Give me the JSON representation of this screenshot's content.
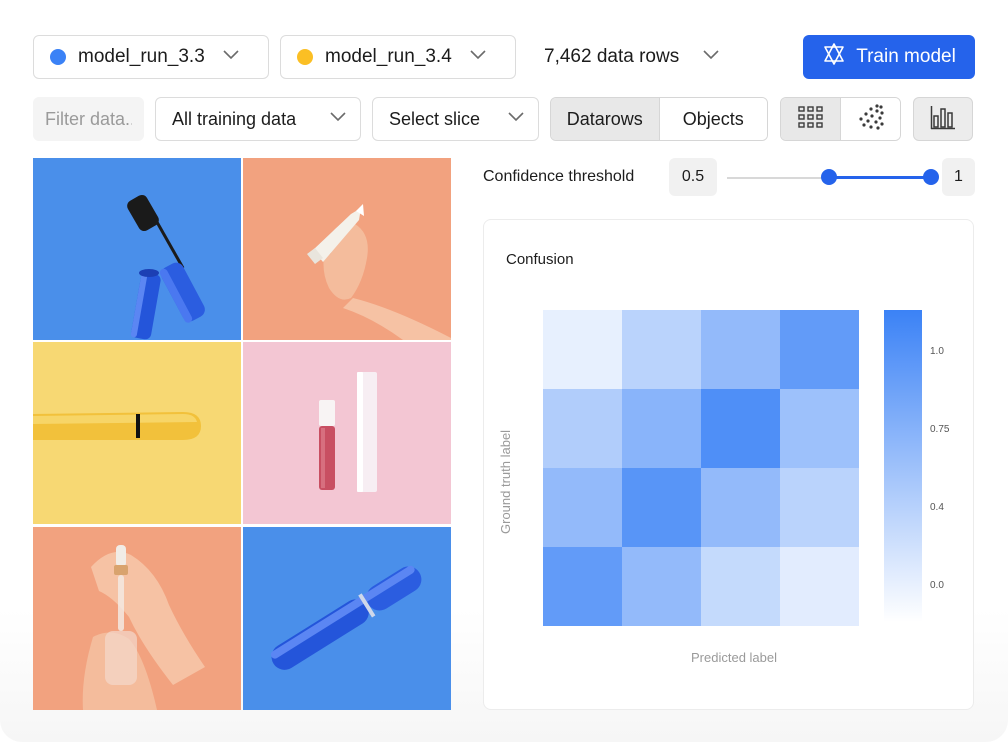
{
  "models": [
    {
      "name": "model_run_3.3",
      "color": "#3b82f6"
    },
    {
      "name": "model_run_3.4",
      "color": "#fbbf24"
    }
  ],
  "data_rows_label": "7,462 data rows",
  "train_button_label": "Train model",
  "filter": {
    "placeholder": "Filter data..."
  },
  "training_scope_select": {
    "value": "All training data"
  },
  "slice_select": {
    "value": "Select slice"
  },
  "mode_toggle": {
    "options": [
      "Datarows",
      "Objects"
    ],
    "active": "Datarows"
  },
  "view_toggle": {
    "options": [
      "grid-icon",
      "scatter-icon"
    ],
    "active": "grid-icon"
  },
  "chart_toggle_icon": "bar-chart-icon",
  "thumbnails": [
    {
      "subject": "mascara",
      "background": "#4a8fea"
    },
    {
      "subject": "hand-tube",
      "background": "#f2a27f"
    },
    {
      "subject": "lipstick-pen",
      "background": "#f7d873"
    },
    {
      "subject": "lip-gloss",
      "background": "#f3c6d3"
    },
    {
      "subject": "dropper",
      "background": "#f2a27f"
    },
    {
      "subject": "blue-mascara",
      "background": "#4a8fea"
    }
  ],
  "confidence": {
    "label": "Confidence threshold",
    "min": 0.5,
    "max": 1,
    "min_label": "0.5",
    "max_label": "1"
  },
  "accent_color": "#2563eb",
  "confusion": {
    "title": "Confusion",
    "xlabel": "Predicted label",
    "ylabel": "Ground truth label",
    "colorbar_ticks": [
      "1.0",
      "0.75",
      "0.4",
      "0.0"
    ]
  },
  "chart_data": {
    "type": "heatmap",
    "title": "Confusion",
    "xlabel": "Predicted label",
    "ylabel": "Ground truth label",
    "values": [
      [
        0.12,
        0.35,
        0.55,
        0.8
      ],
      [
        0.4,
        0.6,
        0.9,
        0.5
      ],
      [
        0.55,
        0.85,
        0.55,
        0.35
      ],
      [
        0.8,
        0.55,
        0.3,
        0.15
      ]
    ],
    "colorbar": {
      "min": 0.0,
      "max": 1.0,
      "ticks": [
        1.0,
        0.75,
        0.4,
        0.0
      ]
    },
    "colormap": [
      "#ffffff",
      "#3b82f6"
    ]
  }
}
